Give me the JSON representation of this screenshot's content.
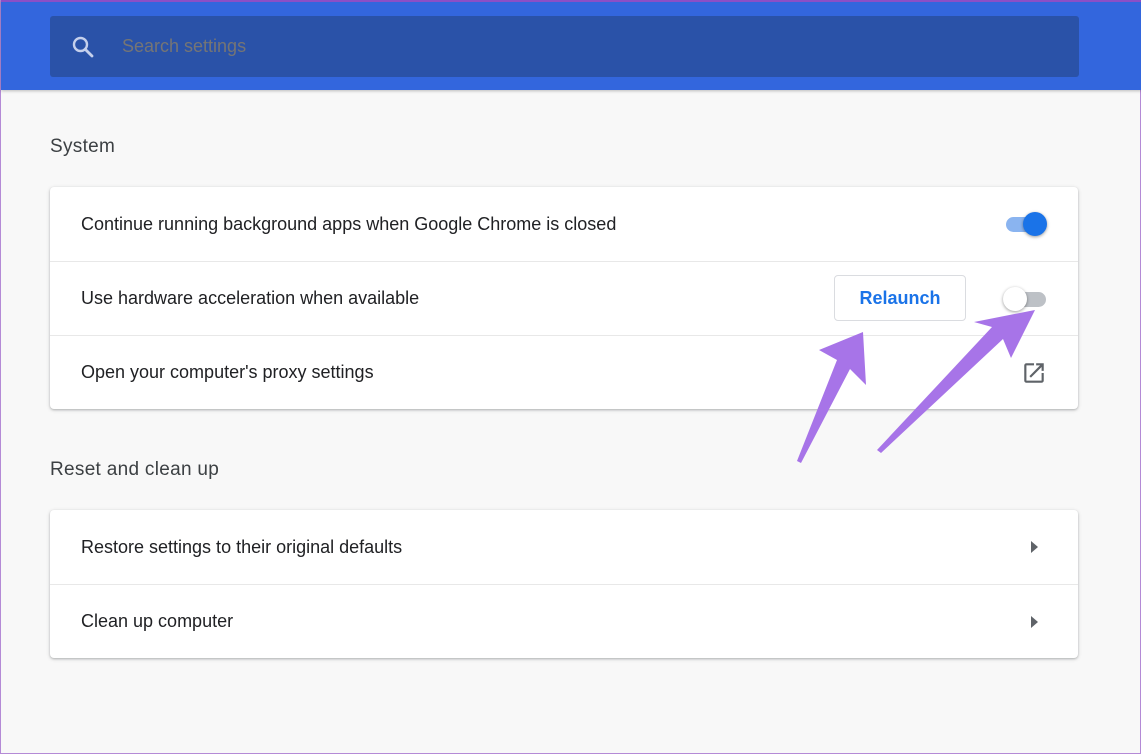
{
  "search": {
    "placeholder": "Search settings",
    "icon": "search-icon"
  },
  "colors": {
    "header": "#3366dd",
    "search_box": "#2a52a8",
    "accent": "#1a73e8",
    "annotation_arrow": "#a774e8"
  },
  "system": {
    "title": "System",
    "rows": [
      {
        "label": "Continue running background apps when Google Chrome is closed",
        "control": "toggle",
        "state": "on"
      },
      {
        "label": "Use hardware acceleration when available",
        "control": "toggle",
        "state": "off",
        "button_label": "Relaunch"
      },
      {
        "label": "Open your computer's proxy settings",
        "control": "launch-icon"
      }
    ]
  },
  "reset": {
    "title": "Reset and clean up",
    "rows": [
      {
        "label": "Restore settings to their original defaults",
        "control": "arrow-right-icon"
      },
      {
        "label": "Clean up computer",
        "control": "arrow-right-icon"
      }
    ]
  }
}
